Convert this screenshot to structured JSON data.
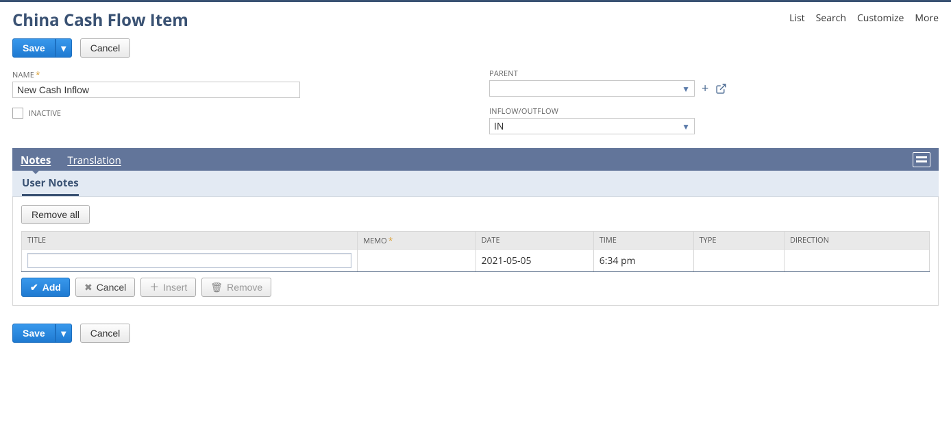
{
  "header": {
    "title": "China Cash Flow Item",
    "links": {
      "list": "List",
      "search": "Search",
      "customize": "Customize",
      "more": "More"
    }
  },
  "actions": {
    "save": "Save",
    "cancel": "Cancel"
  },
  "form": {
    "name_label": "NAME",
    "name_value": "New Cash Inflow",
    "inactive_label": "INACTIVE",
    "parent_label": "PARENT",
    "parent_value": "",
    "inflow_label": "INFLOW/OUTFLOW",
    "inflow_value": "IN"
  },
  "tabs": {
    "notes": "Notes",
    "translation": "Translation"
  },
  "subtabs": {
    "user_notes": "User Notes"
  },
  "notes_panel": {
    "remove_all": "Remove all",
    "columns": {
      "title": "TITLE",
      "memo": "MEMO",
      "date": "DATE",
      "time": "TIME",
      "type": "TYPE",
      "direction": "DIRECTION"
    },
    "row": {
      "title": "",
      "memo": "",
      "date": "2021-05-05",
      "time": "6:34 pm",
      "type": "",
      "direction": ""
    },
    "row_actions": {
      "add": "Add",
      "cancel": "Cancel",
      "insert": "Insert",
      "remove": "Remove"
    }
  }
}
